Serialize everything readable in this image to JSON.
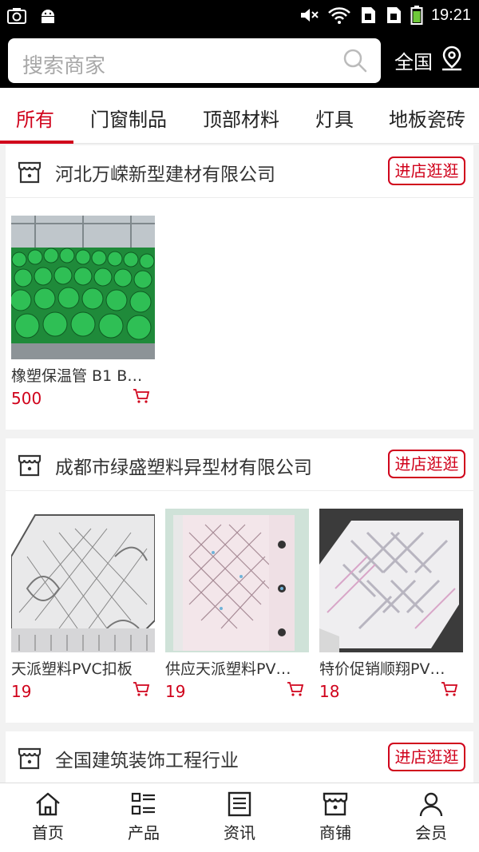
{
  "status_bar": {
    "time": "19:21"
  },
  "search": {
    "placeholder": "搜索商家"
  },
  "region": {
    "label": "全国"
  },
  "tabs": [
    {
      "label": "所有",
      "active": true
    },
    {
      "label": "门窗制品",
      "active": false
    },
    {
      "label": "顶部材料",
      "active": false
    },
    {
      "label": "灯具",
      "active": false
    },
    {
      "label": "地板瓷砖",
      "active": false
    }
  ],
  "stores": [
    {
      "name": "河北万嵘新型建材有限公司",
      "visit_label": "进店逛逛",
      "products": [
        {
          "name": "橡塑保温管 B1 B…",
          "price": "500"
        }
      ]
    },
    {
      "name": "成都市绿盛塑料异型材有限公司",
      "visit_label": "进店逛逛",
      "products": [
        {
          "name": "天派塑料PVC扣板",
          "price": "19"
        },
        {
          "name": "供应天派塑料PV…",
          "price": "19"
        },
        {
          "name": "特价促销顺翔PV…",
          "price": "18"
        }
      ]
    },
    {
      "name": "全国建筑装饰工程行业",
      "visit_label": "进店逛逛",
      "products": []
    }
  ],
  "bottom_nav": [
    {
      "label": "首页",
      "icon": "home-icon"
    },
    {
      "label": "产品",
      "icon": "product-list-icon"
    },
    {
      "label": "资讯",
      "icon": "news-icon"
    },
    {
      "label": "商铺",
      "icon": "shop-icon"
    },
    {
      "label": "会员",
      "icon": "user-icon"
    }
  ],
  "colors": {
    "accent": "#d0021b",
    "header": "#000000",
    "background": "#f2f2f2"
  }
}
